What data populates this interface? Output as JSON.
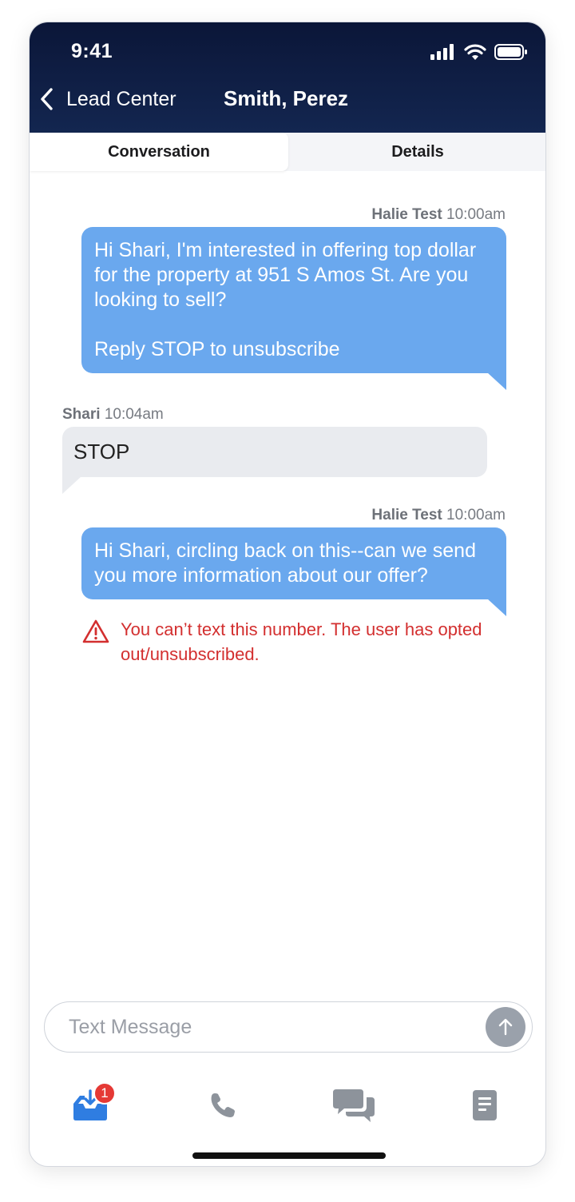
{
  "status_bar": {
    "time": "9:41"
  },
  "header": {
    "back_label": "Lead Center",
    "title": "Smith, Perez"
  },
  "tabs": [
    {
      "label": "Conversation",
      "active": true
    },
    {
      "label": "Details",
      "active": false
    }
  ],
  "messages": [
    {
      "direction": "outgoing",
      "sender": "Halie Test",
      "time": "10:00am",
      "text": "Hi Shari, I'm interested in offering top dollar\nfor the property at 951 S Amos St. Are you\nlooking to sell?\n\nReply STOP to unsubscribe"
    },
    {
      "direction": "incoming",
      "sender": "Shari",
      "time": "10:04am",
      "text": "STOP"
    },
    {
      "direction": "outgoing",
      "sender": "Halie Test",
      "time": "10:00am",
      "text": "Hi Shari, circling back on this--can we send\nyou more information about our offer?"
    }
  ],
  "error": {
    "text": "You can’t text this number. The user has opted out/unsubscribed.",
    "color": "#d32f2f"
  },
  "composer": {
    "placeholder": "Text Message"
  },
  "bottom_nav": {
    "items": [
      {
        "icon": "inbox-download-icon",
        "active": true,
        "badge": "1"
      },
      {
        "icon": "phone-icon",
        "active": false
      },
      {
        "icon": "chat-bubbles-icon",
        "active": false
      },
      {
        "icon": "document-icon",
        "active": false
      }
    ]
  },
  "colors": {
    "header": "#0b1638",
    "outgoing_bubble": "#6aa8ee",
    "incoming_bubble": "#e9ebef",
    "accent": "#2f7de1"
  }
}
